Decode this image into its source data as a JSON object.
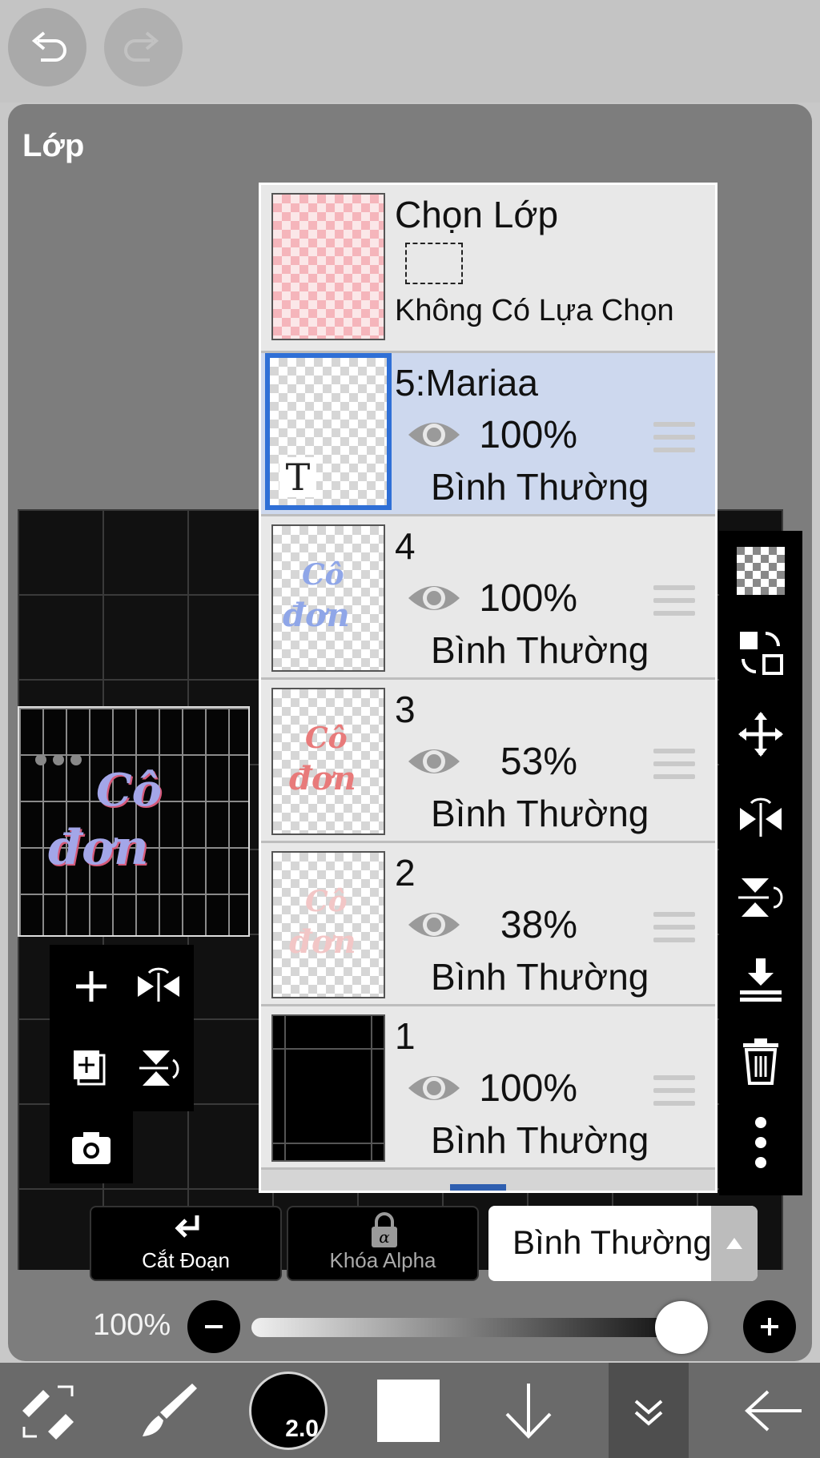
{
  "panel": {
    "title": "Lớp"
  },
  "selection_layer": {
    "title": "Chọn Lớp",
    "status": "Không Có Lựa Chọn"
  },
  "layers": [
    {
      "name": "5:Mariaa",
      "opacity": "100%",
      "blend": "Bình Thường",
      "selected": true,
      "thumb_text": "T"
    },
    {
      "name": "4",
      "opacity": "100%",
      "blend": "Bình Thường",
      "selected": false
    },
    {
      "name": "3",
      "opacity": "53%",
      "blend": "Bình Thường",
      "selected": false
    },
    {
      "name": "2",
      "opacity": "38%",
      "blend": "Bình Thường",
      "selected": false
    },
    {
      "name": "1",
      "opacity": "100%",
      "blend": "Bình Thường",
      "selected": false
    }
  ],
  "bottom_controls": {
    "clipping_label": "Cắt Đoạn",
    "alpha_lock_label": "Khóa Alpha",
    "blend_mode": "Bình Thường",
    "opacity_label": "100%",
    "opacity_value": 1.0
  },
  "toolbar": {
    "brush_size": "2.0",
    "color": "#ffffff"
  },
  "colors": {
    "panel_bg": "#7d7d7d",
    "selected_row": "#cdd8ee",
    "selected_border": "#2f6fd6"
  }
}
